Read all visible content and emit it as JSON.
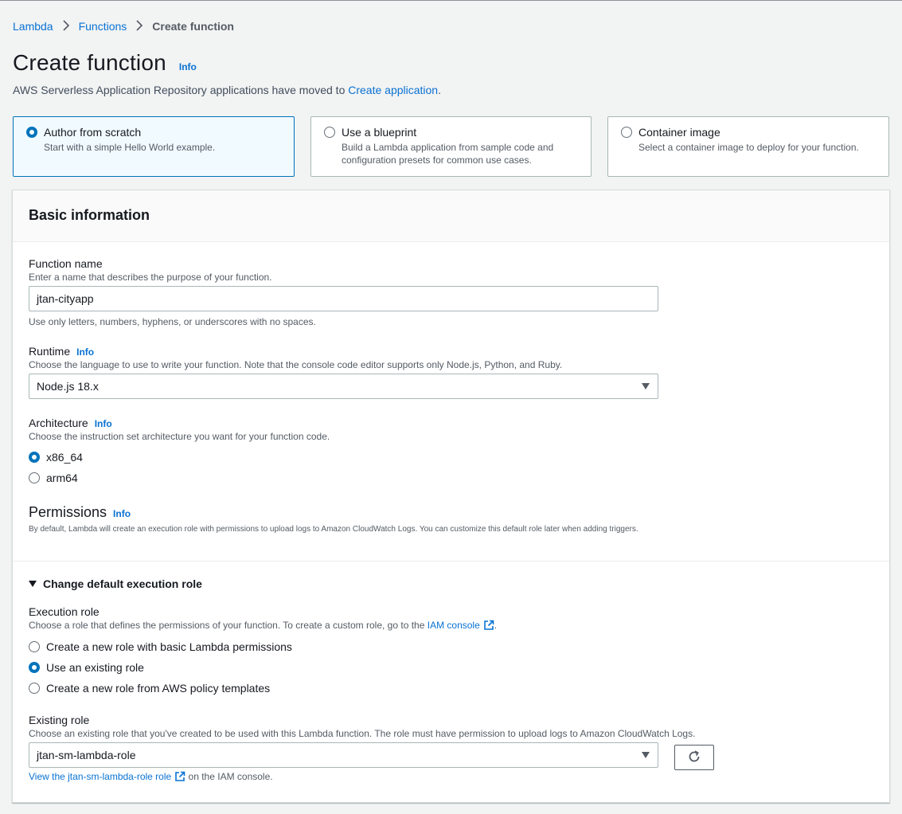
{
  "breadcrumb": {
    "items": [
      "Lambda",
      "Functions"
    ],
    "current": "Create function"
  },
  "page": {
    "title": "Create function",
    "info": "Info",
    "subtitle_text": "AWS Serverless Application Repository applications have moved to",
    "subtitle_link": "Create application",
    "subtitle_end": "."
  },
  "options": [
    {
      "title": "Author from scratch",
      "desc": "Start with a simple Hello World example.",
      "selected": true
    },
    {
      "title": "Use a blueprint",
      "desc": "Build a Lambda application from sample code and configuration presets for common use cases.",
      "selected": false
    },
    {
      "title": "Container image",
      "desc": "Select a container image to deploy for your function.",
      "selected": false
    }
  ],
  "basic": {
    "title": "Basic information",
    "function_name": {
      "label": "Function name",
      "desc": "Enter a name that describes the purpose of your function.",
      "value": "jtan-cityapp",
      "hint": "Use only letters, numbers, hyphens, or underscores with no spaces."
    },
    "runtime": {
      "label": "Runtime",
      "info": "Info",
      "desc": "Choose the language to use to write your function. Note that the console code editor supports only Node.js, Python, and Ruby.",
      "value": "Node.js 18.x"
    },
    "architecture": {
      "label": "Architecture",
      "info": "Info",
      "desc": "Choose the instruction set architecture you want for your function code.",
      "options": [
        "x86_64",
        "arm64"
      ],
      "selected": "x86_64"
    },
    "permissions": {
      "title": "Permissions",
      "info": "Info",
      "desc": "By default, Lambda will create an execution role with permissions to upload logs to Amazon CloudWatch Logs. You can customize this default role later when adding triggers."
    },
    "change_role": {
      "label": "Change default execution role"
    },
    "execution_role": {
      "label": "Execution role",
      "desc": "Choose a role that defines the permissions of your function. To create a custom role, go to the",
      "desc_link": "IAM console",
      "desc_end": ".",
      "options": [
        "Create a new role with basic Lambda permissions",
        "Use an existing role",
        "Create a new role from AWS policy templates"
      ],
      "selected": "Use an existing role"
    },
    "existing_role": {
      "label": "Existing role",
      "desc": "Choose an existing role that you've created to be used with this Lambda function. The role must have permission to upload logs to Amazon CloudWatch Logs.",
      "value": "jtan-sm-lambda-role",
      "view_link": "View the jtan-sm-lambda-role role",
      "view_end": "on the IAM console."
    }
  },
  "colors": {
    "link": "#0972d3",
    "selected_border": "#0073bb",
    "selected_bg": "#f1faff",
    "page_bg": "#f2f3f3"
  }
}
